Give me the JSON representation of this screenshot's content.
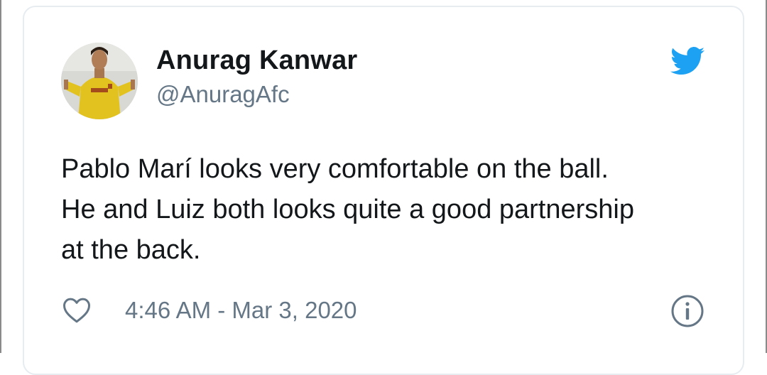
{
  "tweet": {
    "display_name": "Anurag Kanwar",
    "handle": "@AnuragAfc",
    "text": "Pablo Marí looks very comfortable on the ball.\nHe and Luiz both looks quite a good partnership\nat the back.",
    "timestamp": "4:46 AM - Mar 3, 2020"
  },
  "icons": {
    "avatar": "profile-photo",
    "brand": "twitter-bird-icon",
    "like": "heart-icon",
    "info": "info-icon"
  },
  "colors": {
    "brand": "#1da1f2",
    "secondary_text": "#657786",
    "primary_text": "#14171a",
    "border": "#e6ecf0"
  }
}
